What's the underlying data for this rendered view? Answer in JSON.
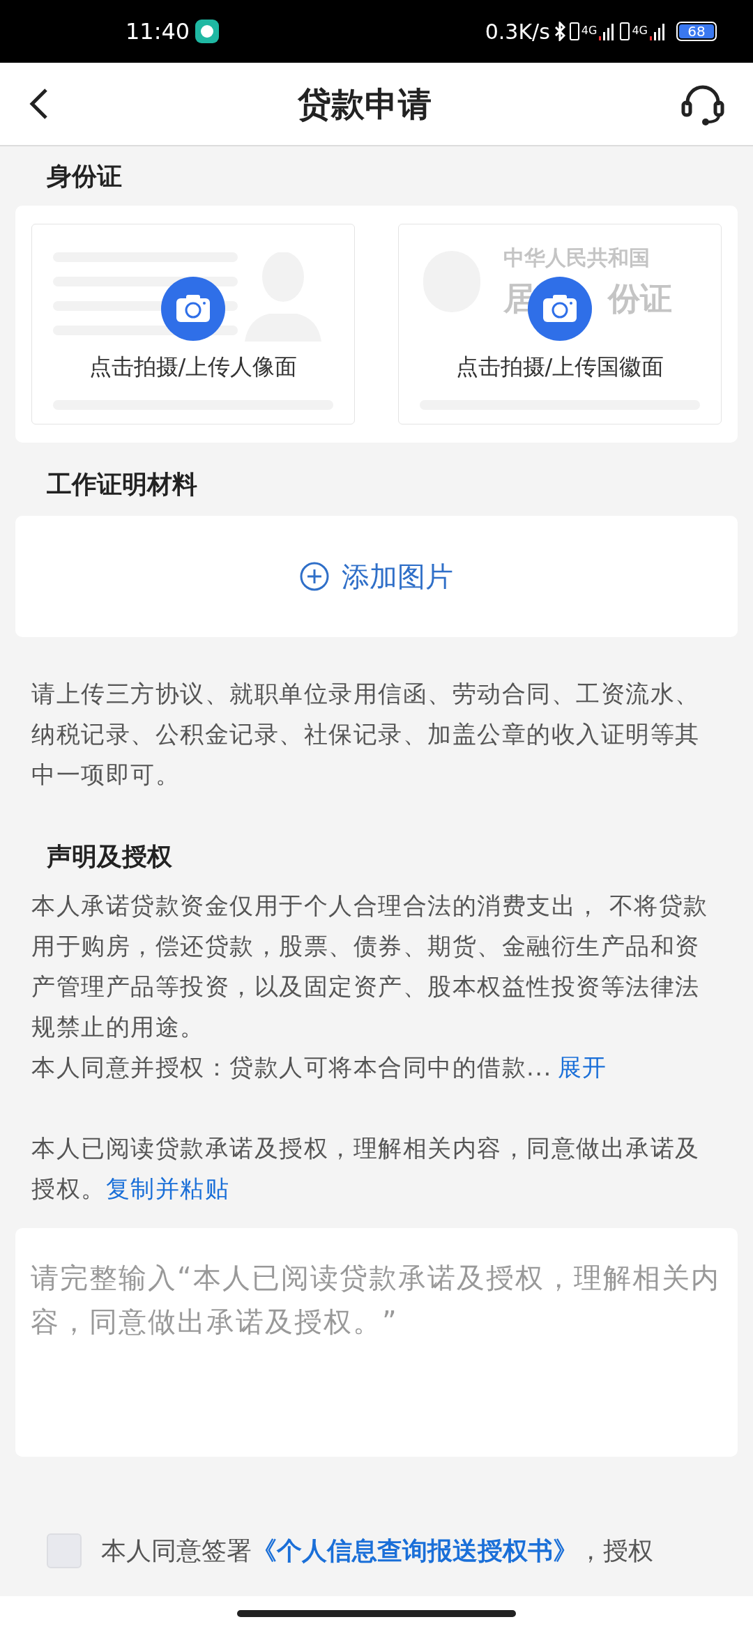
{
  "status_bar": {
    "time": "11:40",
    "speed": "0.3K/s",
    "network_1": "4G",
    "network_2": "4G",
    "battery": "68"
  },
  "header": {
    "title": "贷款申请"
  },
  "id_section": {
    "title": "身份证",
    "cards": [
      {
        "kind": "portrait",
        "label": "点击拍摄/上传人像面"
      },
      {
        "kind": "emblem",
        "label": "点击拍摄/上传国徽面",
        "watermark_line_1": "中华人民共和国",
        "watermark_line_2_left": "居",
        "watermark_line_2_right": "份证"
      }
    ]
  },
  "work_section": {
    "title": "工作证明材料",
    "add_button": "添加图片",
    "hint": "请上传三方协议、就职单位录用信函、劳动合同、工资流水、纳税记录、公积金记录、社保记录、加盖公章的收入证明等其中一项即可。"
  },
  "declaration": {
    "title": "声明及授权",
    "body": "本人承诺贷款资金仅用于个人合理合法的消费支出， 不将贷款用于购房，偿还贷款，股票、债券、期货、金融衍生产品和资产管理产品等投资，以及固定资产、股本权益性投资等法律法规禁止的用途。",
    "authorization": "本人同意并授权：贷款人可将本合同中的借款...",
    "expand_link": "展开",
    "statement": "本人已阅读贷款承诺及授权，理解相关内容，同意做出承诺及授权。",
    "copy_link": "复制并粘贴",
    "input_placeholder": "请完整输入“本人已阅读贷款承诺及授权，理解相关内容，同意做出承诺及授权。”"
  },
  "consent": {
    "checked": false,
    "text_before": "本人同意签署",
    "document_link": "《个人信息查询报送授权书》",
    "text_after": "，授权"
  }
}
